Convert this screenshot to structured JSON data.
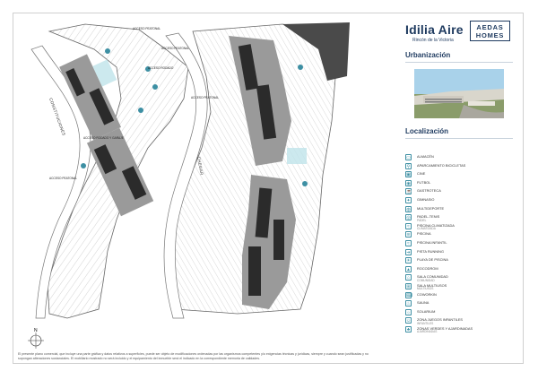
{
  "brand": {
    "name": "Idilia Aire",
    "subtitle": "Rincón de la Victoria",
    "logo_line1": "AEDAS",
    "logo_line2": "HOMES"
  },
  "sections": {
    "urbanizacion": "Urbanización",
    "localizacion": "Localización"
  },
  "map": {
    "road_left": "CONSTITUCIONES",
    "road_center": "CHEGAR",
    "access_labels": [
      "ACCESO PEATONAL",
      "ACCESO PEATONAL",
      "ACCESO RODADO",
      "ACCESO PEATONAL",
      "ACCESO RODADO Y GARAJE",
      "ACCESO PEATONAL"
    ],
    "compass_letter": "N"
  },
  "legend": [
    {
      "icon": "storage-icon",
      "glyph": "▭",
      "label": "ALMACÉN",
      "sub": ""
    },
    {
      "icon": "bicycle-icon",
      "glyph": "⚲",
      "label": "APARCAMIENTO BICICLETAS",
      "sub": ""
    },
    {
      "icon": "cinema-icon",
      "glyph": "▣",
      "label": "CINE",
      "sub": ""
    },
    {
      "icon": "football-icon",
      "glyph": "◉",
      "label": "FUTBOL",
      "sub": ""
    },
    {
      "icon": "gastro-icon",
      "glyph": "☕",
      "label": "GASTROTECA",
      "sub": ""
    },
    {
      "icon": "gym-icon",
      "glyph": "✦",
      "label": "GIMNASIO",
      "sub": ""
    },
    {
      "icon": "multisport-icon",
      "glyph": "◍",
      "label": "MULTIDEPORTE",
      "sub": ""
    },
    {
      "icon": "padel-icon",
      "glyph": "◎",
      "label": "PADEL-TENIS",
      "sub": "PÁDEL"
    },
    {
      "icon": "heated-pool-icon",
      "glyph": "≈",
      "label": "PISCINA CLIMATIZADA",
      "sub": "CLIMATIZADA"
    },
    {
      "icon": "pool-icon",
      "glyph": "≋",
      "label": "PISCINA",
      "sub": ""
    },
    {
      "icon": "kids-pool-icon",
      "glyph": "≈",
      "label": "PISCINA INFANTIL",
      "sub": ""
    },
    {
      "icon": "running-icon",
      "glyph": "➜",
      "label": "PISTA RUNNING",
      "sub": ""
    },
    {
      "icon": "beach-icon",
      "glyph": "☀",
      "label": "PLAYA DE PISCINA",
      "sub": ""
    },
    {
      "icon": "rocodrom-icon",
      "glyph": "▲",
      "label": "ROCODROM",
      "sub": ""
    },
    {
      "icon": "community-room-icon",
      "glyph": "⌂",
      "label": "SALA COMUNIDAD",
      "sub": "COMUNIDAD"
    },
    {
      "icon": "multiuse-room-icon",
      "glyph": "⊞",
      "label": "SALA MULTIUSOS",
      "sub": "MULTIUSOS"
    },
    {
      "icon": "coworking-icon",
      "glyph": "⌨",
      "label": "COWORKIN",
      "sub": ""
    },
    {
      "icon": "sauna-icon",
      "glyph": "♨",
      "label": "SAUNA",
      "sub": ""
    },
    {
      "icon": "solarium-icon",
      "glyph": "☼",
      "label": "SOLARIUM",
      "sub": ""
    },
    {
      "icon": "playground-icon",
      "glyph": "☺",
      "label": "ZONA JUEGOS INFANTILES",
      "sub": "INFANTILES"
    },
    {
      "icon": "garden-icon",
      "glyph": "♣",
      "label": "ZONAS VERDES Y AJARDINADAS",
      "sub": "AJARDINADAS"
    }
  ],
  "disclaimer": "El presente plano comercial, que incluye una parte gráfica y datos relativos a superficies, puede ser objeto de modificaciones ordenadas por las organismos competentes y/o exigencias técnicas y jurídicas, siempre y cuando sean justificadas y no supongan alteraciones sustanciales. El mobiliario mostrado no será incluido y el equipamiento del inmueble será el indicado en la correspondiente memoria de calidades.",
  "colors": {
    "brand": "#1e3a5f",
    "accent": "#3d8fa3",
    "building": "#9a9a9a",
    "roof": "#2b2b2b",
    "rock": "#4a4a4a"
  }
}
